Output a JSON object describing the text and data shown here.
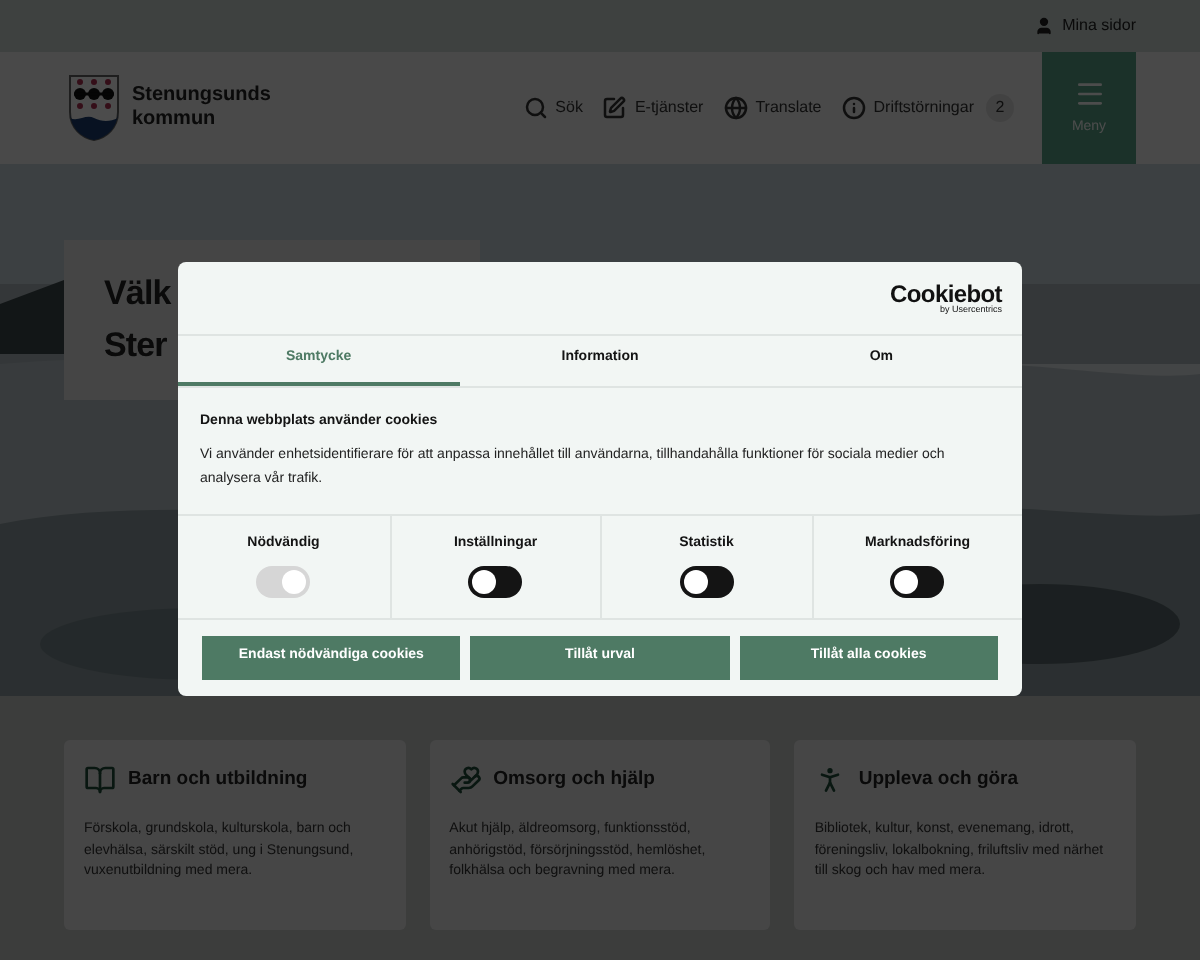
{
  "top_bar": {
    "link": "Mina sidor"
  },
  "header": {
    "logo_text": [
      "Stenungsunds",
      "kommun"
    ],
    "nav": [
      {
        "kind": "search",
        "label": "Sök"
      },
      {
        "kind": "edit",
        "label": "E-tjänster"
      },
      {
        "kind": "globe",
        "label": "Translate"
      },
      {
        "kind": "info",
        "label": "Driftstörningar",
        "count": "2"
      }
    ],
    "menu_button": "Meny"
  },
  "hero": {
    "heading": [
      "Välk",
      "Ster"
    ]
  },
  "cards": [
    {
      "kind": "book",
      "title": "Barn och utbildning",
      "text": "Förskola, grundskola, kulturskola, barn och elevhälsa, särskilt stöd, ung i Stenungsund, vuxenutbildning med mera."
    },
    {
      "kind": "heart",
      "title": "Omsorg och hjälp",
      "text": "Akut hjälp, äldreomsorg, funktionsstöd, anhörigstöd, försörjningsstöd, hemlöshet, folkhälsa och begravning med mera."
    },
    {
      "kind": "hiker",
      "title": "Uppleva och göra",
      "text": "Bibliotek, kultur, konst, evenemang, idrott, föreningsliv, lokalbokning, friluftsliv med närhet till skog och hav med mera."
    }
  ],
  "cookie_dialog": {
    "brand": "Cookiebot",
    "brand_sub": "by Usercentrics",
    "tabs": [
      {
        "label": "Samtycke",
        "selected": true
      },
      {
        "label": "Information",
        "selected": false
      },
      {
        "label": "Om",
        "selected": false
      }
    ],
    "heading": "Denna webbplats använder cookies",
    "text": "Vi använder enhetsidentifierare för att anpassa innehållet till användarna, tillhandahålla funktioner för sociala medier och analysera vår trafik.",
    "categories": [
      {
        "label": "Nödvändig",
        "on": true,
        "disabled": true
      },
      {
        "label": "Inställningar",
        "on": false,
        "disabled": false
      },
      {
        "label": "Statistik",
        "on": false,
        "disabled": false
      },
      {
        "label": "Marknadsföring",
        "on": false,
        "disabled": false
      }
    ],
    "buttons": [
      "Endast nödvändiga cookies",
      "Tillåt urval",
      "Tillåt alla cookies"
    ]
  }
}
